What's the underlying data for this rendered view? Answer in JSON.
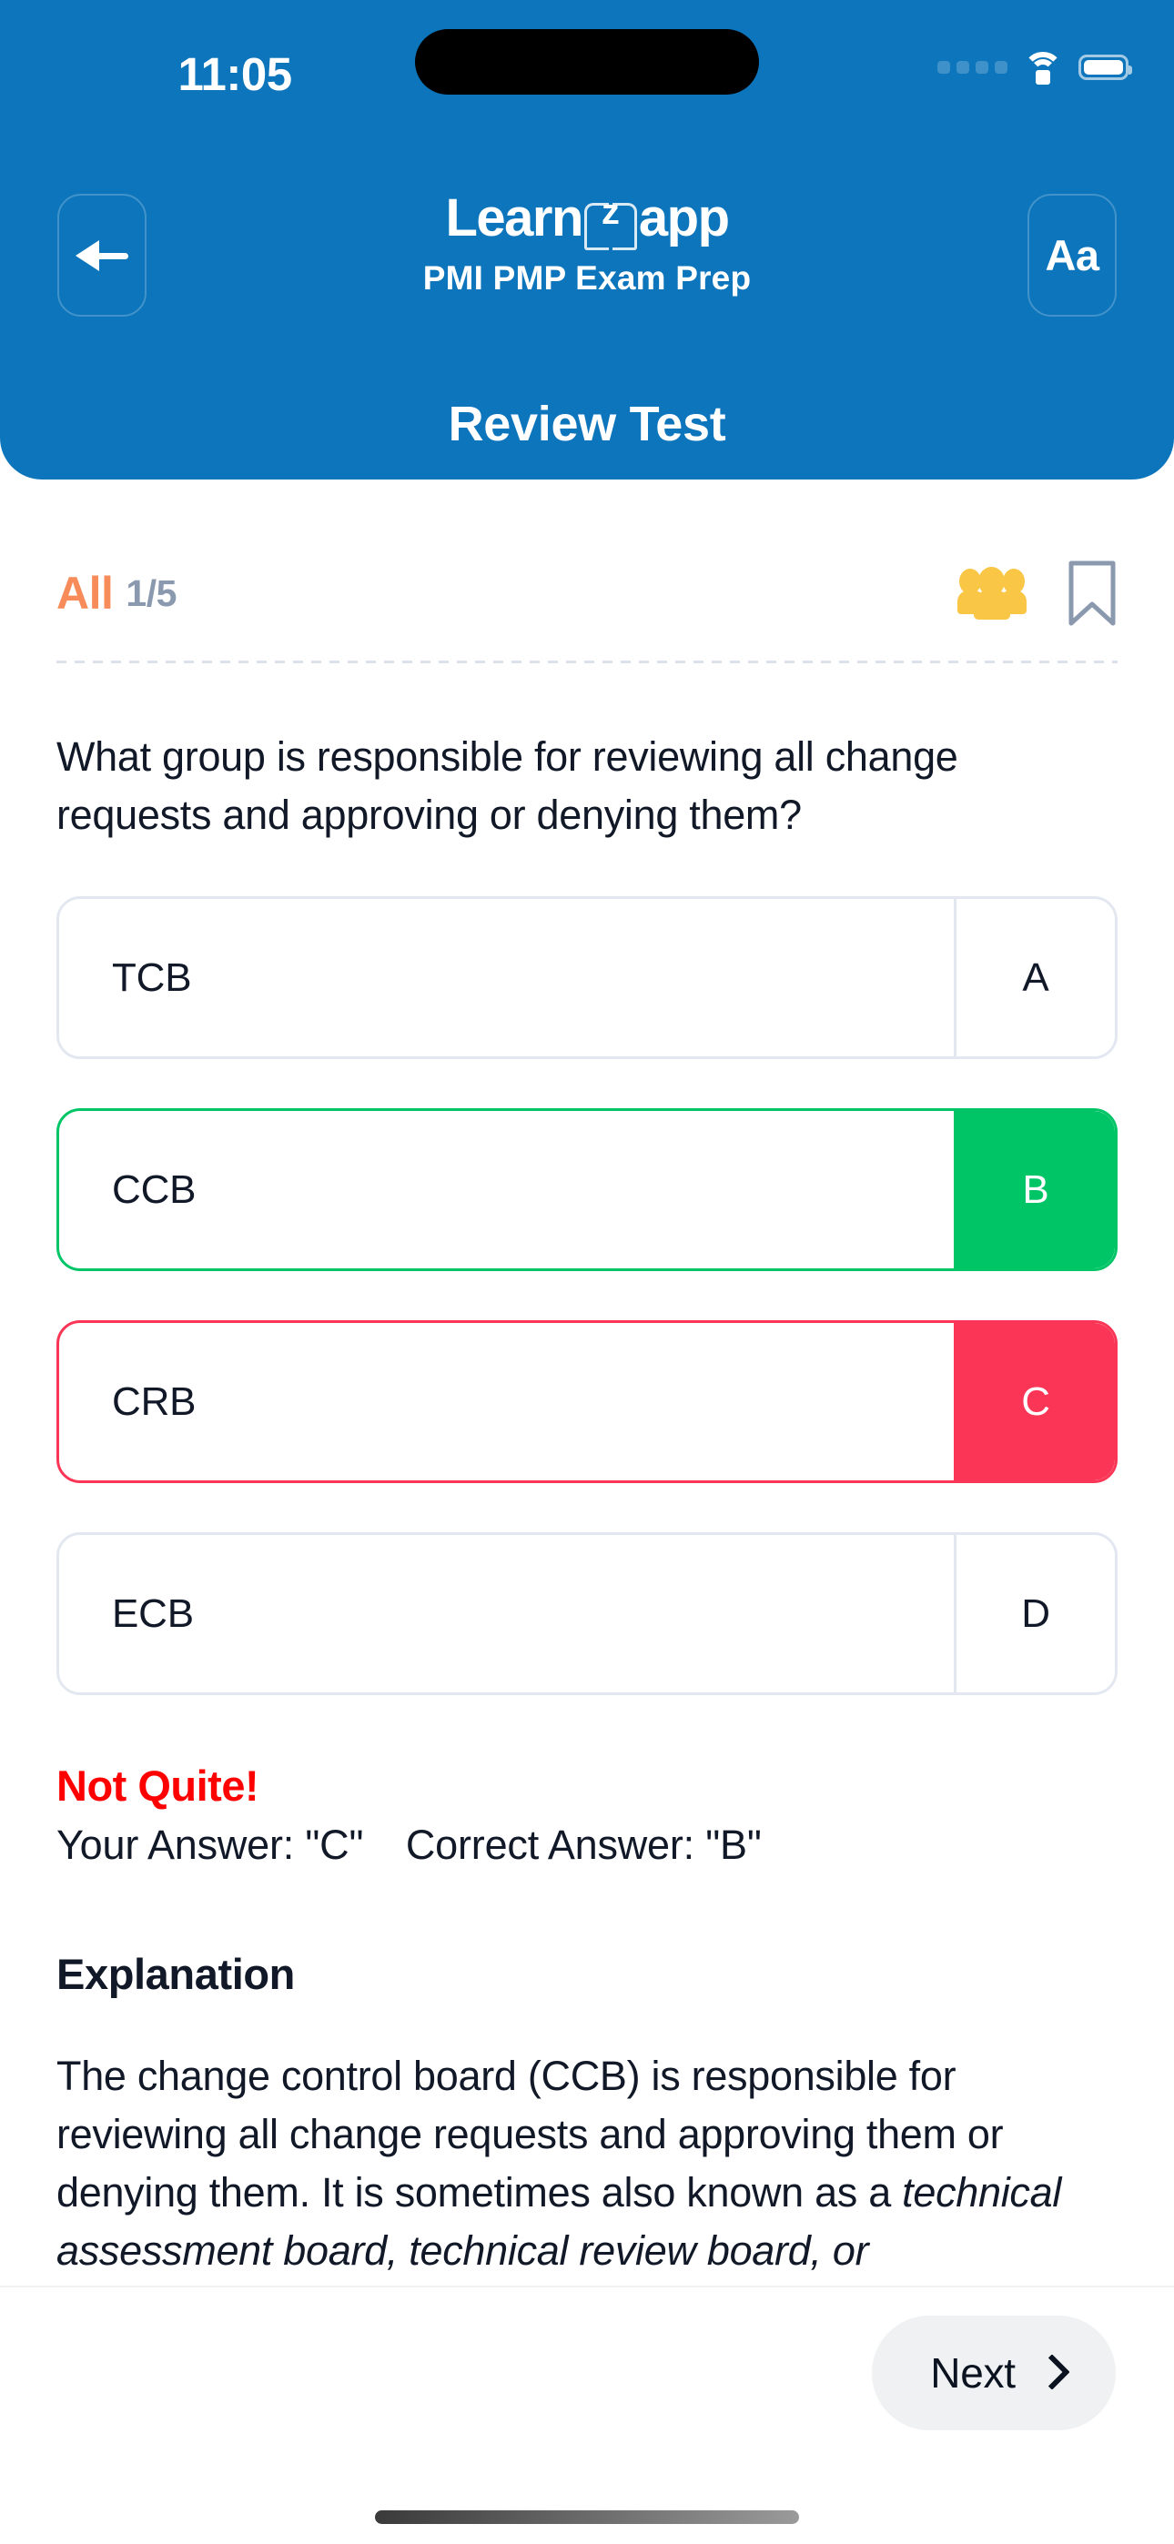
{
  "status_bar": {
    "time": "11:05",
    "signal_icon": "signal-dots-icon",
    "wifi_icon": "wifi-icon",
    "battery_icon": "battery-icon"
  },
  "header": {
    "back_icon": "back-arrow-icon",
    "font_size_button_label": "Aa",
    "logo_left": "Learn",
    "logo_mark": "z",
    "logo_right": "app",
    "subtitle": "PMI  PMP  Exam Prep",
    "page_title": "Review Test",
    "background_color": "#0D75BC"
  },
  "meta": {
    "filter_label": "All",
    "counter": "1/5",
    "people_icon": "people-group-icon",
    "bookmark_icon": "bookmark-icon",
    "filter_color": "#F78C5A",
    "counter_color": "#8A99AE",
    "people_icon_color": "#F9C646",
    "bookmark_icon_color": "#8A99AE"
  },
  "question": {
    "text": "What group is responsible for reviewing all change requests and approving or denying them?"
  },
  "options": [
    {
      "letter": "A",
      "text": "TCB",
      "state": "neutral"
    },
    {
      "letter": "B",
      "text": "CCB",
      "state": "correct"
    },
    {
      "letter": "C",
      "text": "CRB",
      "state": "wrong"
    },
    {
      "letter": "D",
      "text": "ECB",
      "state": "neutral"
    }
  ],
  "result": {
    "verdict": "Not Quite!",
    "your_answer_label": "Your Answer: \"C\"",
    "correct_answer_label": "Correct Answer: \"B\"",
    "verdict_color": "#FF0000"
  },
  "explanation": {
    "heading": "Explanation",
    "paragraph_part1": "The change control board (CCB) is responsible for reviewing all change requests and approving them or denying them. It is sometimes also known as a ",
    "paragraph_italic": "technical assessment board, technical review board, or"
  },
  "footer": {
    "next_label": "Next",
    "chevron_icon": "chevron-right-icon",
    "next_button_color": "#F0F1F2"
  },
  "palette": {
    "correct_green": "#00C566",
    "wrong_red": "#FA3556",
    "option_border": "#E3E8F0",
    "text_dark": "#111827"
  }
}
